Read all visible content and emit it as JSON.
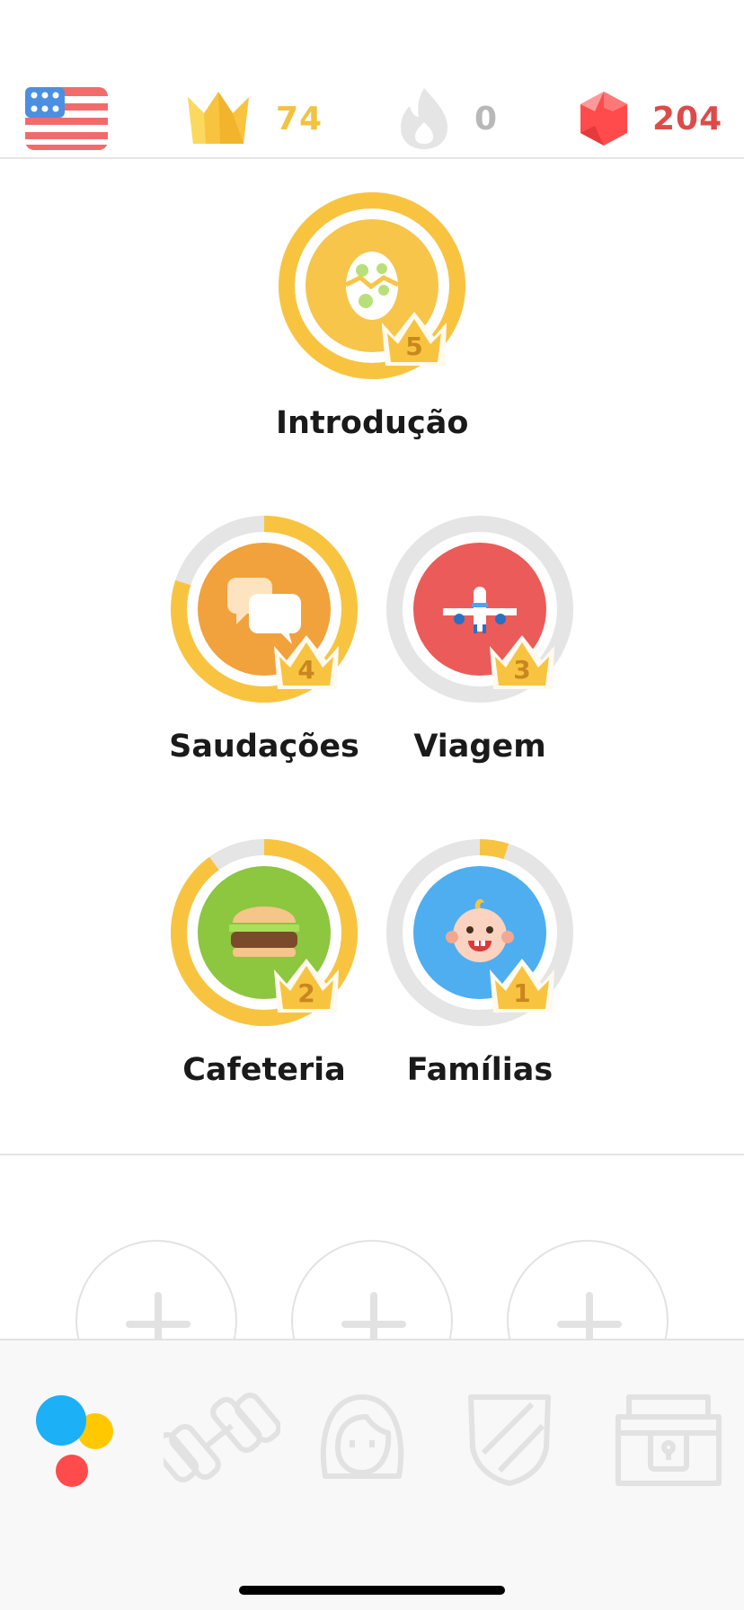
{
  "stats": {
    "course_flag": "flag-us-icon",
    "crowns": "74",
    "streak": "0",
    "gems": "204"
  },
  "colors": {
    "gold": "#f8c440",
    "track_gray": "#e5e5e5",
    "gem_red": "#de4a4a",
    "tab_active_blue": "#1cb0f6"
  },
  "skills": [
    {
      "name": "Introdução",
      "level": "5",
      "progress": 1.0,
      "icon": "egg-icon",
      "color": "#f6c54a"
    },
    {
      "name": "Saudações",
      "level": "4",
      "progress": 0.8,
      "icon": "speech-bubbles-icon",
      "color": "#f1a23c"
    },
    {
      "name": "Viagem",
      "level": "3",
      "progress": 0.0,
      "icon": "airplane-icon",
      "color": "#eb5b59"
    },
    {
      "name": "Cafeteria",
      "level": "2",
      "progress": 0.9,
      "icon": "burger-icon",
      "color": "#8dc63f"
    },
    {
      "name": "Famílias",
      "level": "1",
      "progress": 0.05,
      "icon": "baby-icon",
      "color": "#4eaef0"
    }
  ],
  "locked_skills": [
    "plus-icon",
    "plus-icon",
    "plus-icon"
  ],
  "tabs": [
    {
      "name": "learn",
      "icon": "learn-icon",
      "active": true
    },
    {
      "name": "practice",
      "icon": "dumbbell-icon",
      "active": false
    },
    {
      "name": "profile",
      "icon": "profile-icon",
      "active": false
    },
    {
      "name": "leagues",
      "icon": "shield-icon",
      "active": false
    },
    {
      "name": "shop",
      "icon": "treasure-chest-icon",
      "active": false
    }
  ]
}
